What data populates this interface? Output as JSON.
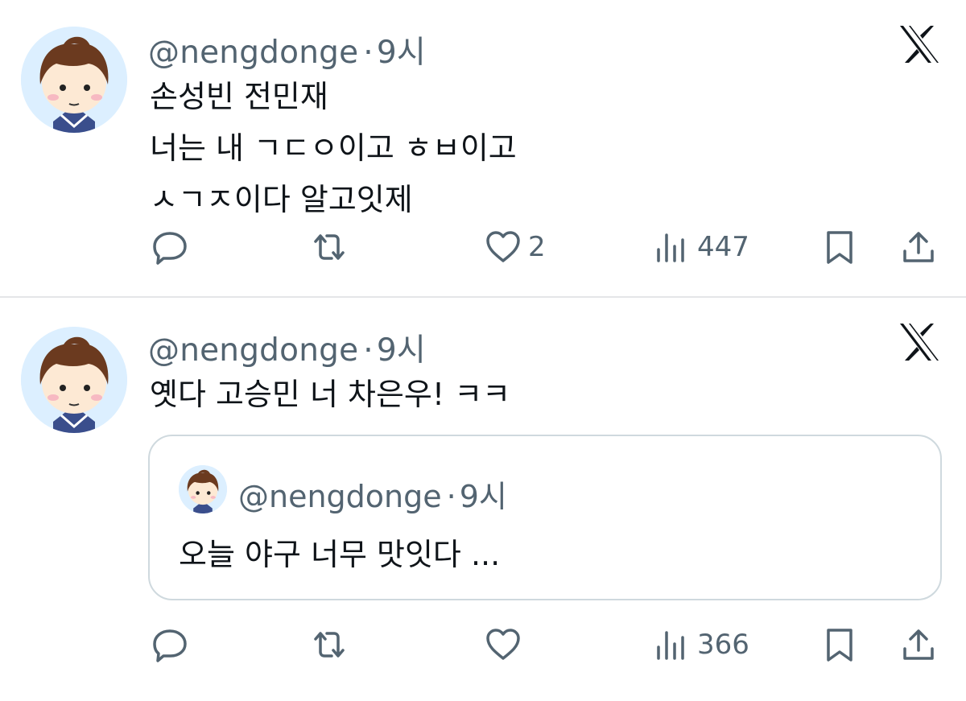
{
  "tweets": [
    {
      "handle": "@nengdonge",
      "dot": "·",
      "time": "9시",
      "lines": [
        "손성빈 전민재",
        "너는 내 ㄱㄷㅇ이고 ㅎㅂ이고",
        "ㅅㄱㅈ이다 알고잇제"
      ],
      "likes": "2",
      "views": "447",
      "icons": {
        "reply": "reply-icon",
        "retweet": "retweet-icon",
        "like": "heart-icon",
        "views": "views-icon",
        "bookmark": "bookmark-icon",
        "share": "share-icon",
        "logo": "x-logo-icon"
      }
    },
    {
      "handle": "@nengdonge",
      "dot": "·",
      "time": "9시",
      "lines": [
        "옛다 고승민 너 차은우! ㅋㅋ"
      ],
      "likes": "",
      "views": "366",
      "quote": {
        "handle": "@nengdonge",
        "dot": "·",
        "time": "9시",
        "text": "오늘 야구 너무 맛잇다 ..."
      }
    }
  ],
  "colors": {
    "text": "#0f1419",
    "muted": "#536471",
    "avatar_bg": "#dcefff",
    "divider": "#e4e6e8",
    "quote_border": "#cfd9de"
  }
}
